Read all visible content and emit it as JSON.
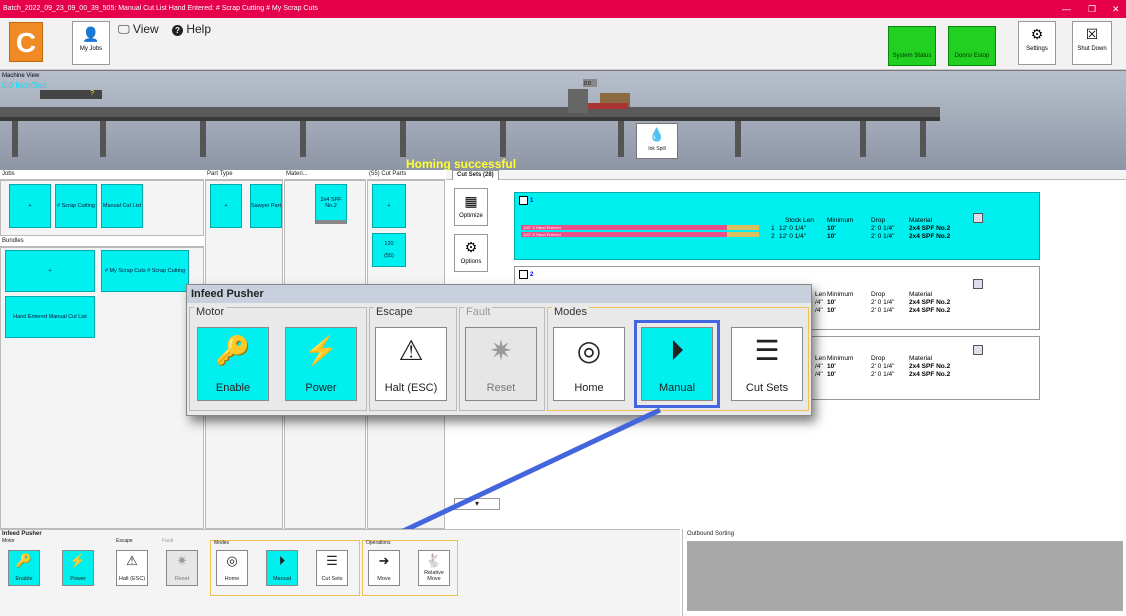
{
  "title_bar": {
    "text": "Batch_2022_09_23_09_00_39_505: Manual Cut List  Hand Entered: # Scrap Cutting  # My Scrap Cuts",
    "minimize": "—",
    "maximize": "❐",
    "close": "✕"
  },
  "toolbar": {
    "logo_letter": "C",
    "my_jobs": "My Jobs",
    "view": "View",
    "help": "Help",
    "system_status": "System Status",
    "doors_estop": "Doors/ Estop",
    "settings": "Settings",
    "shut_down": "Shut Down"
  },
  "machine_view": {
    "label": "Machine View",
    "speed": "0.0 Inch/Sec",
    "value_box": "?",
    "head_readout": "0.0",
    "status": "Homing successful",
    "ink_spill": "Ink Spill"
  },
  "jobs": {
    "header": "Jobs",
    "add": "+",
    "items": [
      "# Scrap Cutting",
      "Manual Cut List"
    ]
  },
  "bundles": {
    "header": "Bundles",
    "add": "+",
    "items": [
      "# My Scrap Cuts # Scrap Cutting",
      "Hand Entered Manual Cut List"
    ]
  },
  "part_type": {
    "header": "Part Type",
    "add": "+",
    "item": "Sawyer Part"
  },
  "materials": {
    "header": "Materi...",
    "item": "2x4 SPF No.2"
  },
  "cut_parts": {
    "header": "(55) Cut Parts",
    "add": "+",
    "count": "120",
    "total": "(55)"
  },
  "cut_sets": {
    "tab": "Cut Sets (28)",
    "optimize": "Optimize",
    "options": "Options",
    "columns": [
      "Stock Len",
      "Minimum",
      "Drop",
      "Material"
    ],
    "sets": [
      {
        "num": "1",
        "rows": [
          {
            "idx": "1",
            "stock": "12' 0 1/4\"",
            "min": "10'",
            "drop": "2' 0 1/4\"",
            "mat": "2x4 SPF No.2",
            "bar": "120\" S Hand Entered"
          },
          {
            "idx": "2",
            "stock": "12' 0 1/4\"",
            "min": "10'",
            "drop": "2' 0 1/4\"",
            "mat": "2x4 SPF No.2",
            "bar": "120\" S Hand Entered"
          }
        ]
      },
      {
        "num": "2",
        "head": "Len",
        "rows": [
          {
            "stock": "/4\"",
            "min": "10'",
            "drop": "2' 0 1/4\"",
            "mat": "2x4 SPF No.2"
          },
          {
            "stock": "/4\"",
            "min": "10'",
            "drop": "2' 0 1/4\"",
            "mat": "2x4 SPF No.2"
          }
        ]
      },
      {
        "num": "3",
        "head": "Len",
        "rows": [
          {
            "stock": "/4\"",
            "min": "10'",
            "drop": "2' 0 1/4\"",
            "mat": "2x4 SPF No.2"
          },
          {
            "stock": "/4\"",
            "min": "10'",
            "drop": "2' 0 1/4\"",
            "mat": "2x4 SPF No.2"
          }
        ]
      }
    ]
  },
  "popup": {
    "title": "Infeed Pusher",
    "groups": {
      "motor": "Motor",
      "escape": "Escape",
      "fault": "Fault",
      "modes": "Modes"
    },
    "buttons": {
      "enable": "Enable",
      "power": "Power",
      "halt": "Halt (ESC)",
      "reset": "Reset",
      "home": "Home",
      "manual": "Manual",
      "cut_sets": "Cut Sets"
    }
  },
  "bottom_dock": {
    "title": "Infeed Pusher",
    "groups": {
      "motor": "Motor",
      "escape": "Escape",
      "fault": "Fault",
      "modes": "Modes",
      "operations": "Operations"
    },
    "buttons": {
      "enable": "Enable",
      "power": "Power",
      "halt": "Halt (ESC)",
      "reset": "Reset",
      "home": "Home",
      "manual": "Manual",
      "cut_sets": "Cut Sets",
      "move": "Move",
      "relative_move": "Relative Move"
    }
  },
  "outbound": {
    "header": "Outbound Sorting"
  },
  "colors": {
    "title": "#e6004c",
    "cyan": "#00f0f0",
    "green": "#22d022",
    "highlight": "#4466dd",
    "pink": "#e8508a",
    "tan": "#d8c060"
  }
}
